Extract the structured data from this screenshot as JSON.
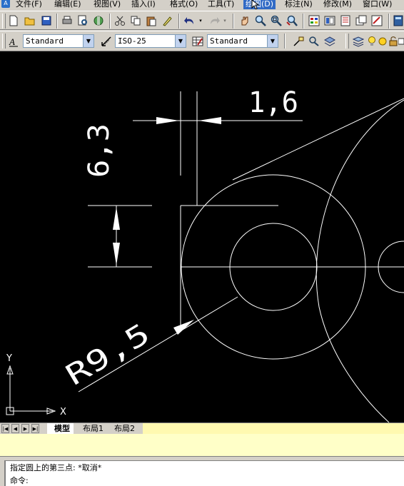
{
  "menubar": {
    "items": [
      {
        "label": "文件(F)"
      },
      {
        "label": "编辑(E)"
      },
      {
        "label": "视图(V)"
      },
      {
        "label": "插入(I)"
      },
      {
        "label": "格式(O)"
      },
      {
        "label": "工具(T)"
      },
      {
        "label": "绘图(D)",
        "active": true
      },
      {
        "label": "标注(N)"
      },
      {
        "label": "修改(M)"
      },
      {
        "label": "窗口(W)"
      }
    ]
  },
  "styles_toolbar": {
    "text_style": "Standard",
    "dim_style": "ISO-25",
    "table_style": "Standard"
  },
  "drawing": {
    "dim_horizontal": "1,6",
    "dim_vertical": "6,3",
    "dim_radius": "R9,5"
  },
  "ucs": {
    "x_label": "X",
    "y_label": "Y"
  },
  "tabs": {
    "model": "模型",
    "layout1": "布局1",
    "layout2": "布局2"
  },
  "command": {
    "history_line": "指定圆上的第三点: *取消*",
    "prompt": "命令:"
  },
  "colors": {
    "canvas_bg": "#000000",
    "line": "#ffffff",
    "menu_highlight": "#316ac5"
  }
}
